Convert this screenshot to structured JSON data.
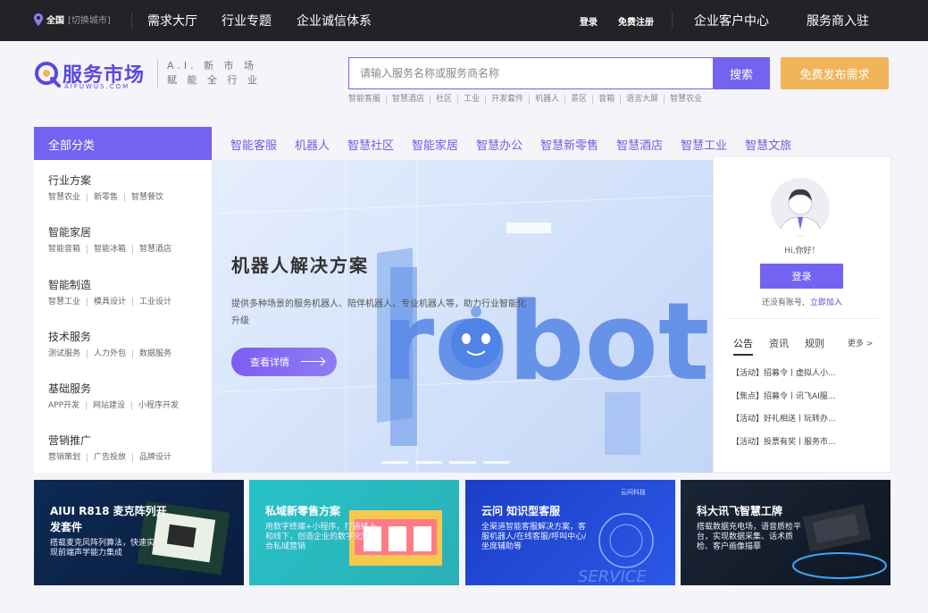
{
  "topbar": {
    "city": "全国",
    "switch_city": "[切换城市]",
    "nav": [
      "需求大厅",
      "行业专题",
      "企业诚信体系"
    ],
    "login": "登录",
    "register": "免费注册",
    "enterprise_center": "企业客户中心",
    "provider_join": "服务商入驻"
  },
  "header": {
    "logo_text": "服务市场",
    "logo_sub": "AIFUWUS.COM",
    "tagline_line1": "A.I. 新 市 场",
    "tagline_line2": "赋 能 全 行 业",
    "search_placeholder": "请输入服务名称或服务商名称",
    "search_button": "搜索",
    "publish_button": "免费发布需求",
    "hot_tags": [
      "智能客服",
      "智慧酒店",
      "社区",
      "工业",
      "开发套件",
      "机器人",
      "景区",
      "音箱",
      "语言大屏",
      "智慧农业"
    ]
  },
  "categories": {
    "header": "全部分类",
    "tabs": [
      "智能客服",
      "机器人",
      "智慧社区",
      "智能家居",
      "智慧办公",
      "智慧新零售",
      "智慧酒店",
      "智慧工业",
      "智慧文旅"
    ],
    "groups": [
      {
        "title": "行业方案",
        "subs": [
          "智慧农业",
          "新零售",
          "智慧餐饮"
        ]
      },
      {
        "title": "智能家居",
        "subs": [
          "智能音箱",
          "智能冰箱",
          "智慧酒店"
        ]
      },
      {
        "title": "智能制造",
        "subs": [
          "智慧工业",
          "模具设计",
          "工业设计"
        ]
      },
      {
        "title": "技术服务",
        "subs": [
          "测试服务",
          "人力外包",
          "数据服务"
        ]
      },
      {
        "title": "基础服务",
        "subs": [
          "APP开发",
          "网站建设",
          "小程序开发"
        ]
      },
      {
        "title": "营销推广",
        "subs": [
          "营销策划",
          "广告投放",
          "品牌设计"
        ]
      }
    ]
  },
  "banner": {
    "title": "机器人解决方案",
    "desc": "提供多种场景的服务机器人、陪伴机器人、专业机器人等，助力行业智能化升级",
    "button": "查看详情",
    "art_text": "robot"
  },
  "user_panel": {
    "greeting": "Hi,你好！",
    "login": "登录",
    "no_account": "还没有账号,",
    "join": "立即加入",
    "tabs": [
      "公告",
      "资讯",
      "规则"
    ],
    "more": "更多 >",
    "notices": [
      "【活动】招募令丨虚拟人小...",
      "【焦点】招募令丨讯飞AI服...",
      "【活动】好礼相送丨玩转办...",
      "【活动】投票有奖丨服务市..."
    ]
  },
  "cards": [
    {
      "title": "AIUI R818 麦克阵列开发套件",
      "desc": "搭载麦克风阵列算法，快速实现前端声学能力集成",
      "color_from": "#0d2a55",
      "color_to": "#0a1e3e"
    },
    {
      "title": "私域新零售方案",
      "desc": "用数字终端+小程序，打通线上和线下，创造企业的数字化整合私域营销",
      "color_from": "#27c2c9",
      "color_to": "#2bb0b6"
    },
    {
      "title": "云问 知识型客服",
      "desc": "全渠道智能客服解决方案，客服机器人/在线客服/呼叫中心/坐席辅助等",
      "brand": "云问科技",
      "art_text": "SERVICE",
      "color_from": "#1b3ec8",
      "color_to": "#2b58e6"
    },
    {
      "title": "科大讯飞智慧工牌",
      "desc": "搭载数据充电场，语音质检平台，实现数据采集、话术质检、客户画像描摹",
      "color_from": "#1a2535",
      "color_to": "#0f1724"
    }
  ],
  "colors": {
    "accent": "#7363f0",
    "publish": "#f2b45a",
    "topbar": "#222326"
  }
}
